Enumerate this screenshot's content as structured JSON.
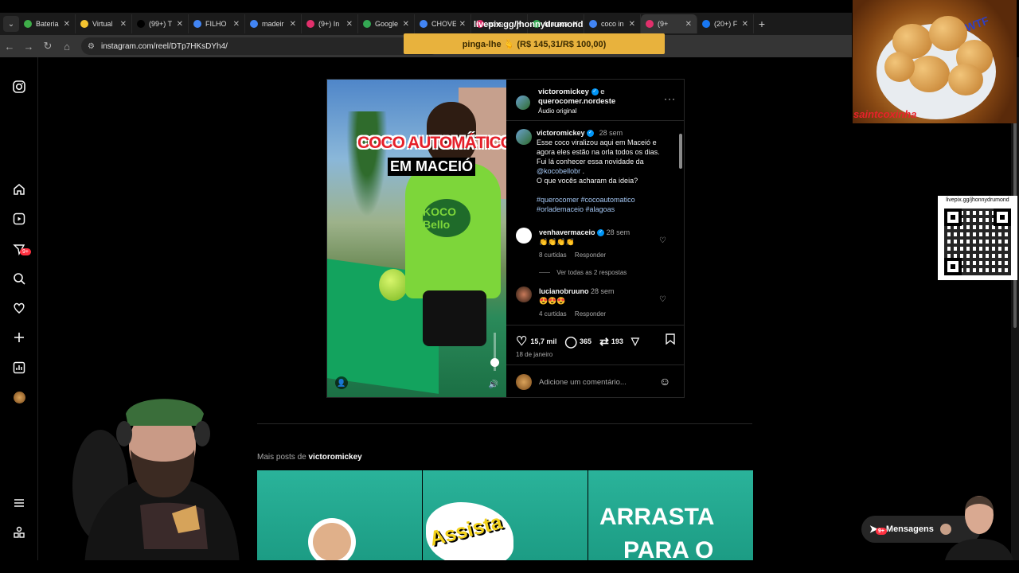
{
  "browser": {
    "tabs": [
      {
        "title": "Bateria",
        "favicon_color": "#3fae49"
      },
      {
        "title": "Virtual",
        "favicon_color": "#f4c430"
      },
      {
        "title": "(99+) T",
        "favicon_color": "#000000"
      },
      {
        "title": "FILHO",
        "favicon_color": "#4285f4"
      },
      {
        "title": "madeir",
        "favicon_color": "#4285f4"
      },
      {
        "title": "(9+) In",
        "favicon_color": "#e1306c"
      },
      {
        "title": "Google",
        "favicon_color": "#34a853"
      },
      {
        "title": "CHOVE",
        "favicon_color": "#4285f4"
      },
      {
        "title": "nove",
        "favicon_color": "#e1306c"
      },
      {
        "title": "Maraca",
        "favicon_color": "#34a853"
      },
      {
        "title": "coco in",
        "favicon_color": "#4285f4"
      },
      {
        "title": "(9+",
        "favicon_color": "#e1306c",
        "active": true
      },
      {
        "title": "(20+) F",
        "favicon_color": "#1877f2"
      }
    ],
    "url": "instagram.com/reel/DTp7HKsDYh4/"
  },
  "overlays": {
    "livepix_top": "livepix.gg/jhonnydrumond",
    "banner": "pinga-lhe 🫰 (R$ 145,31/R$ 100,00)",
    "saintcoxinha": "saintcoxinha",
    "wtf": "WTF",
    "qr_label": "livepix.gg/jhonnydrumond"
  },
  "nav": {
    "messages_badge": "9+",
    "notifications_badge": "9+"
  },
  "post": {
    "video": {
      "caption_line1": "COCO AUTOMÁTICO",
      "caption_line2": "EM MACEIÓ",
      "brand_logo": "KOCO Bello"
    },
    "header": {
      "author": "victoromickey",
      "connector": "e",
      "coauthor": "querocomer.nordeste",
      "audio": "Áudio original"
    },
    "caption": {
      "author": "victoromickey",
      "time": "28 sem",
      "lines": [
        "Esse coco viralizou aqui em Maceió e",
        "agora eles estão na orla todos os dias.",
        "Fui lá conhecer essa novidade da"
      ],
      "mention": "@kocobellobr",
      "question": "O que vocês acharam da ideia?",
      "hashtags_line1": "#querocomer #cocoautomatico",
      "hashtags_line2": "#orlademaceio #alagoas"
    },
    "comments": [
      {
        "user": "venhavermaceio",
        "time": "28 sem",
        "text": "👏👏👏👏",
        "likes": "8 curtidas",
        "reply": "Responder",
        "view_replies": "Ver todas as 2 respostas"
      },
      {
        "user": "lucianobruuno",
        "time": "28 sem",
        "text": "😍😍😍",
        "likes": "4 curtidas",
        "reply": "Responder"
      }
    ],
    "actions": {
      "likes": "15,7 mil",
      "comments": "365",
      "reposts": "193",
      "date": "18 de janeiro"
    },
    "add_comment_placeholder": "Adicione um comentário..."
  },
  "more_posts": {
    "prefix": "Mais posts de",
    "user": "victoromickey",
    "thumb2_text": "Assista",
    "thumb3_line1": "ARRASTA",
    "thumb3_line2": "PARA O"
  },
  "messages_label": "Mensagens",
  "progress_fraction": 0.8
}
